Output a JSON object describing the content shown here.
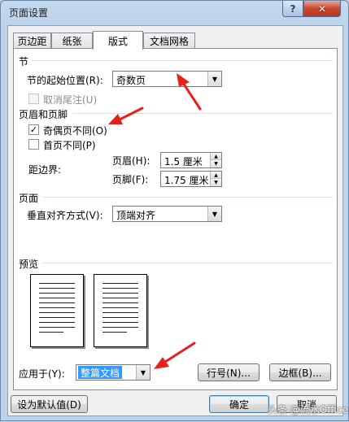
{
  "window": {
    "title": "页面设置",
    "help_label": "?",
    "close_label": "✕"
  },
  "tabs": [
    {
      "label": "页边距",
      "active": false
    },
    {
      "label": "纸张",
      "active": false
    },
    {
      "label": "版式",
      "active": true
    },
    {
      "label": "文档网格",
      "active": false
    }
  ],
  "section": {
    "heading": "节",
    "start_label": "节的起始位置(R):",
    "start_value": "奇数页",
    "suppress_endnotes_label": "取消尾注(U)",
    "suppress_endnotes_checked": false
  },
  "headers_footers": {
    "heading": "页眉和页脚",
    "odd_even_label": "奇偶页不同(O)",
    "odd_even_checked": true,
    "first_page_label": "首页不同(P)",
    "first_page_checked": false,
    "from_edge_label": "距边界:",
    "header_label": "页眉(H):",
    "header_value": "1.5 厘米",
    "footer_label": "页脚(F):",
    "footer_value": "1.75 厘米"
  },
  "page": {
    "heading": "页面",
    "valign_label": "垂直对齐方式(V):",
    "valign_value": "顶端对齐"
  },
  "preview": {
    "heading": "预览"
  },
  "apply": {
    "label": "应用于(Y):",
    "value": "整篇文档",
    "line_numbers_label": "行号(N)...",
    "borders_label": "边框(B)..."
  },
  "footer": {
    "set_default_label": "设为默认值(D)",
    "ok_label": "确定",
    "cancel_label": "取消"
  },
  "watermark": "头条 @流水Office",
  "icons": {
    "dropdown": "chevron-down-icon",
    "spin": "spin-arrows-icon",
    "check": "checkmark-icon"
  },
  "colors": {
    "selection": "#3399ff",
    "annotation_arrow": "#e8201c",
    "close_button": "#c9462b"
  }
}
